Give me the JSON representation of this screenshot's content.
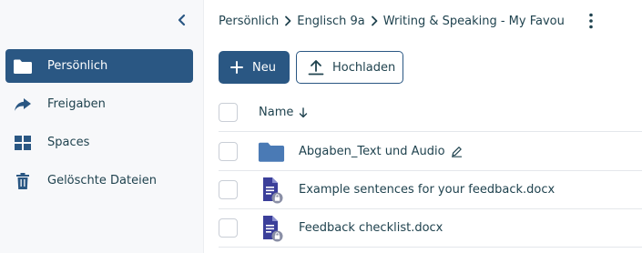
{
  "sidebar": {
    "collapse_icon": "chevron-left-icon",
    "items": [
      {
        "label": "Persönlich",
        "icon": "folder-icon",
        "active": true
      },
      {
        "label": "Freigaben",
        "icon": "share-arrow-icon",
        "active": false
      },
      {
        "label": "Spaces",
        "icon": "grid-icon",
        "active": false
      },
      {
        "label": "Gelöschte Dateien",
        "icon": "trash-icon",
        "active": false
      }
    ]
  },
  "breadcrumb": {
    "items": [
      "Persönlich",
      "Englisch 9a",
      "Writing & Speaking - My Favou..."
    ],
    "more_icon": "kebab-menu-icon"
  },
  "toolbar": {
    "new_label": "Neu",
    "upload_label": "Hochladen"
  },
  "table": {
    "header": {
      "name_label": "Name",
      "sort": "descending"
    },
    "rows": [
      {
        "name": "Abgaben_Text und Audio",
        "type": "folder",
        "editable": true
      },
      {
        "name": "Example sentences for your feedback.docx",
        "type": "docx",
        "locked": true
      },
      {
        "name": "Feedback checklist.docx",
        "type": "docx",
        "locked": true
      }
    ]
  },
  "colors": {
    "primary": "#2a5783",
    "text": "#20434f",
    "sidebar_bg": "#f7f8fa",
    "folder": "#4a7ab5",
    "doc": "#3b3f9a"
  }
}
